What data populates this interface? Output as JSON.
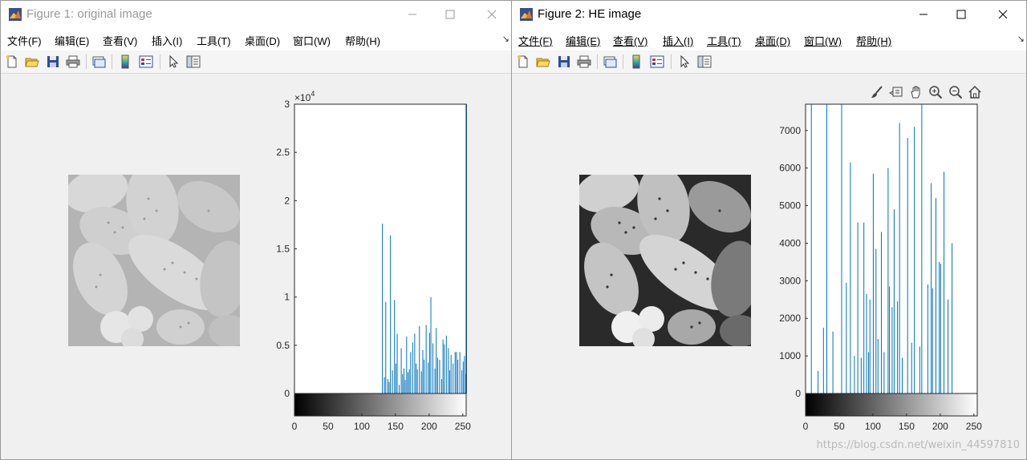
{
  "window1": {
    "title": "Figure 1: original image",
    "menu": [
      "文件(F)",
      "编辑(E)",
      "查看(V)",
      "插入(I)",
      "工具(T)",
      "桌面(D)",
      "窗口(W)",
      "帮助(H)"
    ],
    "histogram": {
      "y_ticks": [
        "0",
        "0.5",
        "1",
        "1.5",
        "2",
        "2.5",
        "3"
      ],
      "x_ticks": [
        "0",
        "50",
        "100",
        "150",
        "200",
        "250"
      ],
      "y_exponent_base": "×10",
      "y_exponent_power": "4"
    }
  },
  "window2": {
    "title": "Figure 2: HE image",
    "menu": [
      "文件(F)",
      "编辑(E)",
      "查看(V)",
      "插入(I)",
      "工具(T)",
      "桌面(D)",
      "窗口(W)",
      "帮助(H)"
    ],
    "histogram": {
      "y_ticks": [
        "0",
        "1000",
        "2000",
        "3000",
        "4000",
        "5000",
        "6000",
        "7000"
      ],
      "x_ticks": [
        "0",
        "50",
        "100",
        "150",
        "200",
        "250"
      ]
    },
    "watermark": "https://blog.csdn.net/weixin_44597810"
  },
  "colors": {
    "stem": "#0072bd",
    "titlebar_active": "#000000",
    "titlebar_inactive": "#999999"
  },
  "chart_data": [
    {
      "type": "bar",
      "xlim": [
        0,
        255
      ],
      "ylim": [
        0,
        30000
      ],
      "grid": false,
      "x": [
        130,
        133,
        135,
        138,
        140,
        142,
        145,
        148,
        150,
        152,
        155,
        158,
        160,
        162,
        164,
        166,
        168,
        170,
        172,
        175,
        178,
        180,
        182,
        185,
        188,
        190,
        192,
        195,
        198,
        200,
        202,
        205,
        208,
        210,
        212,
        215,
        218,
        220,
        222,
        225,
        228,
        230,
        232,
        235,
        238,
        240,
        242,
        245,
        248,
        250,
        252,
        254,
        255
      ],
      "values": [
        17600,
        1700,
        9500,
        1500,
        1200,
        16400,
        2400,
        9700,
        3100,
        6200,
        900,
        4700,
        2000,
        2600,
        1400,
        5900,
        2200,
        2500,
        4300,
        5300,
        6200,
        3100,
        2500,
        7000,
        2300,
        4500,
        3500,
        7100,
        3200,
        6300,
        10000,
        5200,
        2600,
        6800,
        3700,
        3500,
        1500,
        5600,
        5100,
        6000,
        4700,
        2400,
        4000,
        3100,
        4300,
        4300,
        3500,
        4300,
        2400,
        3300,
        3900,
        2000,
        30000
      ]
    },
    {
      "type": "bar",
      "xlim": [
        0,
        255
      ],
      "ylim": [
        0,
        7700
      ],
      "grid": false,
      "x": [
        8,
        18,
        26,
        31,
        40,
        53,
        60,
        66,
        72,
        77,
        82,
        86,
        90,
        93,
        95,
        100,
        104,
        107,
        112,
        116,
        122,
        124,
        128,
        131,
        136,
        139,
        143,
        151,
        157,
        161,
        169,
        172,
        181,
        186,
        188,
        193,
        198,
        200,
        205,
        211,
        217
      ],
      "values": [
        7700,
        600,
        1750,
        7700,
        1650,
        7700,
        2950,
        6150,
        1000,
        4550,
        950,
        4550,
        2650,
        1100,
        2500,
        5850,
        3850,
        1450,
        4300,
        1100,
        6000,
        2850,
        2300,
        4900,
        2450,
        7200,
        950,
        6800,
        1350,
        7100,
        1250,
        7700,
        2900,
        5600,
        2800,
        5200,
        3500,
        3450,
        5900,
        2500,
        4000
      ]
    }
  ]
}
